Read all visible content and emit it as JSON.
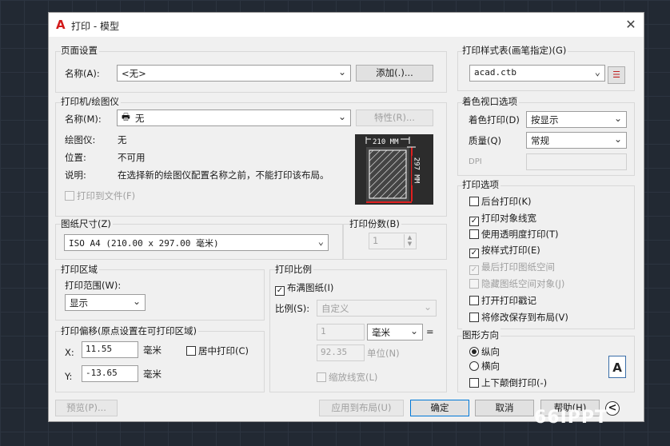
{
  "dialog": {
    "title": "打印 - 模型"
  },
  "page_setup": {
    "group": "页面设置",
    "name_label": "名称(A):",
    "name_value": "<无>",
    "add_button": "添加(.)..."
  },
  "plotter": {
    "group": "打印机/绘图仪",
    "name_label": "名称(M):",
    "name_value": "无",
    "properties_button": "特性(R)...",
    "plotter_label": "绘图仪:",
    "plotter_value": "无",
    "location_label": "位置:",
    "location_value": "不可用",
    "desc_label": "说明:",
    "desc_value": "在选择新的绘图仪配置名称之前，不能打印该布局。",
    "print_to_file": "打印到文件(F)",
    "preview_width": "210 MM",
    "preview_height": "297 MM"
  },
  "paper_size": {
    "group": "图纸尺寸(Z)",
    "value": "ISO A4 (210.00 x 297.00 毫米)"
  },
  "copies": {
    "group": "打印份数(B)",
    "value": "1"
  },
  "plot_area": {
    "group": "打印区域",
    "range_label": "打印范围(W):",
    "range_value": "显示"
  },
  "plot_offset": {
    "group": "打印偏移(原点设置在可打印区域)",
    "x_label": "X:",
    "x_value": "11.55",
    "x_unit": "毫米",
    "y_label": "Y:",
    "y_value": "-13.65",
    "y_unit": "毫米",
    "center": "居中打印(C)"
  },
  "plot_scale": {
    "group": "打印比例",
    "fit": "布满图纸(I)",
    "scale_label": "比例(S):",
    "scale_value": "自定义",
    "num_value": "1",
    "unit_value": "毫米",
    "eq": "=",
    "den_value": "92.35",
    "den_unit": "单位(N)",
    "lineweights": "缩放线宽(L)"
  },
  "style_table": {
    "group": "打印样式表(画笔指定)(G)",
    "value": "acad.ctb"
  },
  "shaded": {
    "group": "着色视口选项",
    "shade_label": "着色打印(D)",
    "shade_value": "按显示",
    "quality_label": "质量(Q)",
    "quality_value": "常规",
    "dpi_label": "DPI"
  },
  "options": {
    "group": "打印选项",
    "items": [
      {
        "label": "后台打印(K)",
        "checked": ""
      },
      {
        "label": "打印对象线宽",
        "checked": "✓"
      },
      {
        "label": "使用透明度打印(T)",
        "checked": ""
      },
      {
        "label": "按样式打印(E)",
        "checked": "✓"
      },
      {
        "label": "最后打印图纸空间",
        "checked": "✓"
      },
      {
        "label": "隐藏图纸空间对象(J)",
        "checked": ""
      },
      {
        "label": "打开打印戳记",
        "checked": ""
      },
      {
        "label": "将修改保存到布局(V)",
        "checked": ""
      }
    ]
  },
  "orientation": {
    "group": "图形方向",
    "portrait": "纵向",
    "landscape": "横向",
    "upside_down": "上下颠倒打印(-)",
    "icon_letter": "A"
  },
  "footer": {
    "preview": "预览(P)...",
    "apply": "应用到布局(U)",
    "ok": "确定",
    "cancel": "取消",
    "help": "帮助(H)",
    "expand": "<"
  },
  "watermark": "66IPPT"
}
